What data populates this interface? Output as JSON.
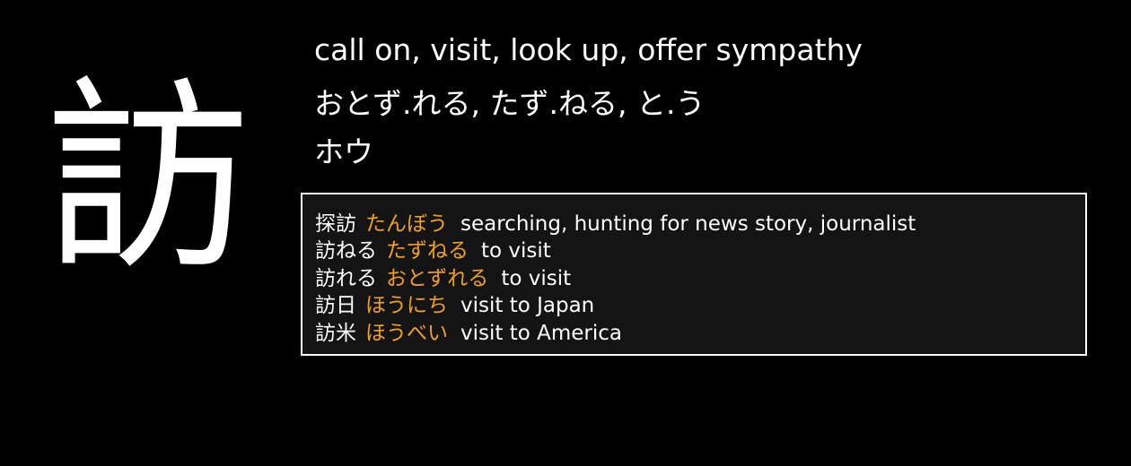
{
  "kanji": "訪",
  "meaning": "call on, visit, look up, offer sympathy",
  "kun_readings": "おとず.れる, たず.ねる, と.う",
  "on_readings": "ホウ",
  "colors": {
    "background": "#000000",
    "text": "#ffffff",
    "reading_accent": "#f0a020",
    "box_background": "#141414",
    "box_border": "#ffffff"
  },
  "vocabulary": [
    {
      "word": "探訪",
      "reading": "たんぼう",
      "gloss": "searching, hunting for news story, journalist"
    },
    {
      "word": "訪ねる",
      "reading": "たずねる",
      "gloss": "to visit"
    },
    {
      "word": "訪れる",
      "reading": "おとずれる",
      "gloss": "to visit"
    },
    {
      "word": "訪日",
      "reading": "ほうにち",
      "gloss": "visit to Japan"
    },
    {
      "word": "訪米",
      "reading": "ほうべい",
      "gloss": "visit to America"
    }
  ]
}
